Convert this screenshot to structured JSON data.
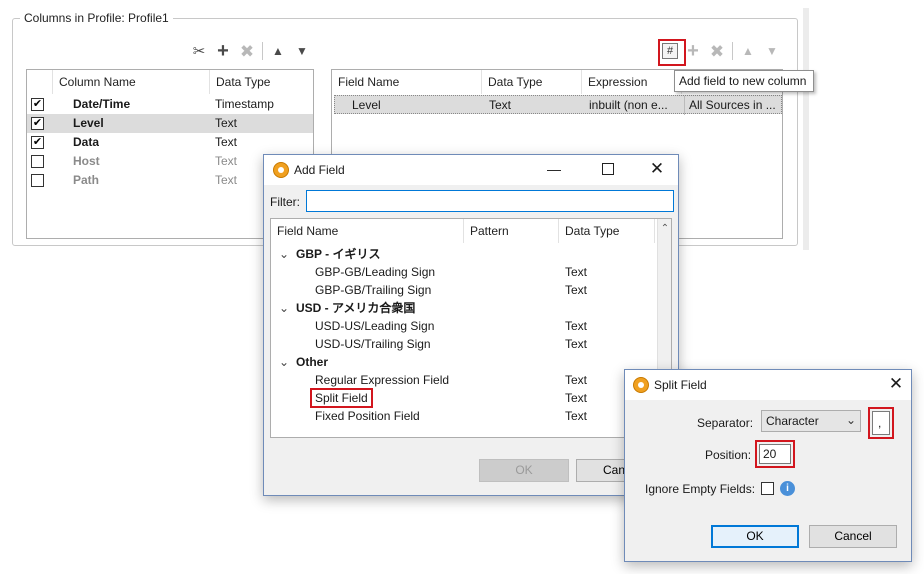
{
  "profile": {
    "group_title": "Columns in Profile: Profile1",
    "left_toolbar_icons": [
      "cut-icon",
      "add-icon",
      "delete-icon",
      "move-up-icon",
      "move-down-icon"
    ],
    "right_toolbar_icons": [
      "add-field-icon",
      "add-icon",
      "delete-icon",
      "move-up-icon",
      "move-down-icon"
    ],
    "columns_table": {
      "headers": [
        "Column Name",
        "Data Type"
      ],
      "rows": [
        {
          "checked": true,
          "name": "Date/Time",
          "type": "Timestamp",
          "selected": false,
          "muted": false
        },
        {
          "checked": true,
          "name": "Level",
          "type": "Text",
          "selected": true,
          "muted": false
        },
        {
          "checked": true,
          "name": "Data",
          "type": "Text",
          "selected": false,
          "muted": false
        },
        {
          "checked": false,
          "name": "Host",
          "type": "Text",
          "selected": false,
          "muted": true
        },
        {
          "checked": false,
          "name": "Path",
          "type": "Text",
          "selected": false,
          "muted": true
        }
      ]
    },
    "fields_table": {
      "headers": [
        "Field Name",
        "Data Type",
        "Expression"
      ],
      "rows": [
        {
          "name": "Level",
          "type": "Text",
          "expression": "inbuilt (non e...",
          "source": "All Sources in ..."
        }
      ]
    },
    "tooltip": "Add field to new column"
  },
  "add_field_dialog": {
    "title": "Add Field",
    "filter_label": "Filter:",
    "filter_value": "",
    "headers": [
      "Field Name",
      "Pattern",
      "Data Type"
    ],
    "groups": [
      {
        "name": "GBP - イギリス",
        "items": [
          {
            "name": "GBP-GB/Leading Sign",
            "type": "Text"
          },
          {
            "name": "GBP-GB/Trailing Sign",
            "type": "Text"
          }
        ]
      },
      {
        "name": "USD - アメリカ合衆国",
        "items": [
          {
            "name": "USD-US/Leading Sign",
            "type": "Text"
          },
          {
            "name": "USD-US/Trailing Sign",
            "type": "Text"
          }
        ]
      },
      {
        "name": "Other",
        "items": [
          {
            "name": "Regular Expression Field",
            "type": "Text"
          },
          {
            "name": "Split Field",
            "type": "Text"
          },
          {
            "name": "Fixed Position Field",
            "type": "Text"
          }
        ]
      }
    ],
    "ok_label": "OK",
    "cancel_label": "Can"
  },
  "split_field_dialog": {
    "title": "Split Field",
    "separator_label": "Separator:",
    "separator_type": "Character",
    "separator_value": ",",
    "position_label": "Position:",
    "position_value": "20",
    "ignore_empty_label": "Ignore Empty Fields:",
    "ignore_empty_checked": false,
    "ok_label": "OK",
    "cancel_label": "Cancel"
  },
  "colors": {
    "highlight_red": "#d2161e",
    "selection_grey": "#dcdcdc",
    "accent_blue": "#0078d7",
    "app_orange": "#f0a020"
  }
}
